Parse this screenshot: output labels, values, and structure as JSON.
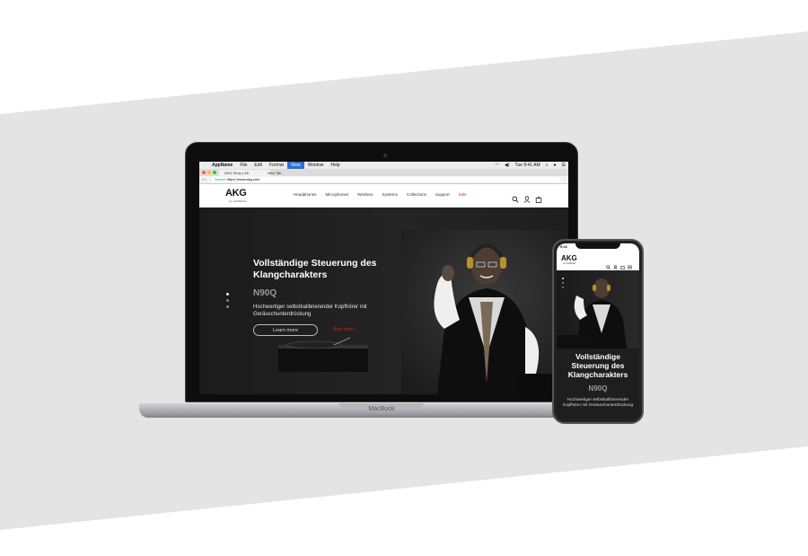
{
  "mac_menubar": {
    "app_name": "AppName",
    "items": [
      "File",
      "Edit",
      "Format",
      "View",
      "Window",
      "Help"
    ],
    "active_item": "View",
    "clock": "Tue 9:41 AM"
  },
  "browser": {
    "tabs": [
      "AKG Shop | AK",
      "New Tab"
    ],
    "secure_label": "Secure",
    "url": "https://www.akg.com"
  },
  "site": {
    "logo": "AKG",
    "logo_sub": "by HARMAN",
    "nav": [
      "Headphones",
      "Microphones",
      "Wireless",
      "Systems",
      "Collections",
      "Support",
      "Sale"
    ],
    "sale_color": "#e31e24",
    "icons": [
      "search-icon",
      "account-icon",
      "cart-icon"
    ]
  },
  "hero": {
    "title": "Vollständige Steuerung des Klangcharakters",
    "model": "N90Q",
    "description": "Hochwertiger selbstkalibrierender Kopfhörer mit Geräuschunterdrückung",
    "learn_more": "Learn more",
    "buy_now": "Buy now ›"
  },
  "laptop_label": "MacBook",
  "phone": {
    "time": "9:41",
    "logo": "AKG",
    "title": "Vollständige Steuerung des Klangcharakters",
    "model": "N90Q",
    "description": "Hochwertiger selbstkalibrierender Kopfhörer mit Geräuschunterdrückung"
  }
}
